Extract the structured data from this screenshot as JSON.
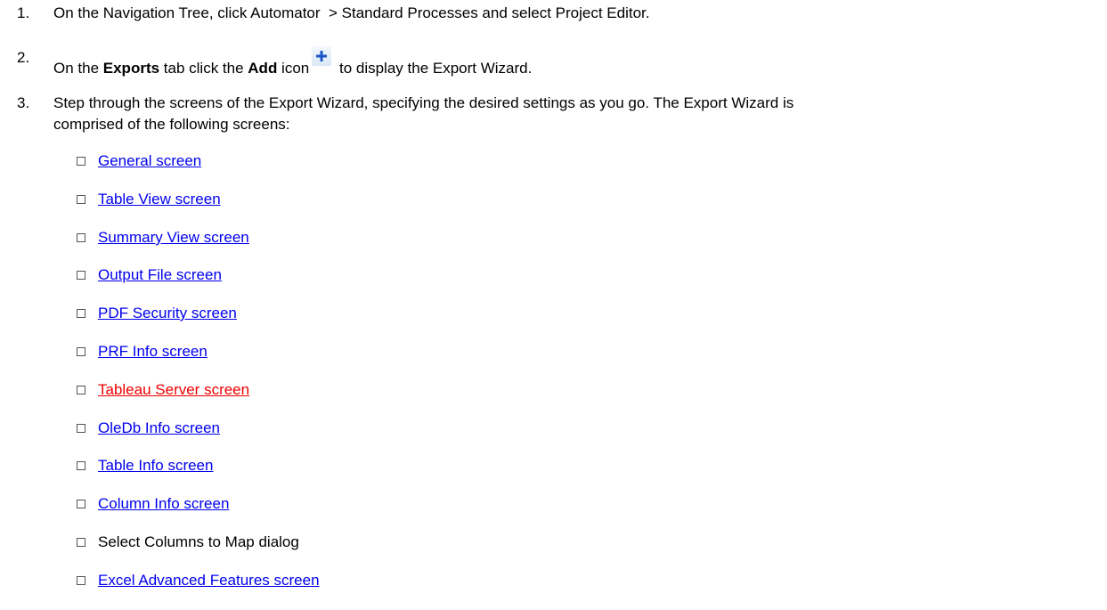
{
  "steps": [
    {
      "number": "1.",
      "text": "On the Navigation Tree, click Automator  > Standard Processes and select Project Editor."
    },
    {
      "number": "2.",
      "t1": "On the ",
      "b1": "Exports",
      "t2": " tab click the ",
      "b2": "Add",
      "t3": " icon",
      "t4": " to display the Export Wizard."
    },
    {
      "number": "3.",
      "line1": "Step through the screens of the Export Wizard, specifying the desired settings as you go. The Export Wizard is",
      "line2": "comprised of the following screens:"
    }
  ],
  "icons": {
    "add": "plus-icon",
    "bullet": "checkbox-square-icon"
  },
  "colors": {
    "link": "#0000ee",
    "link_highlight": "#ee0000",
    "plus": "#1e56c8",
    "text": "#000000"
  },
  "screens": [
    {
      "label": "General screen",
      "link": true,
      "highlight": false
    },
    {
      "label": "Table View screen",
      "link": true,
      "highlight": false
    },
    {
      "label": "Summary View screen",
      "link": true,
      "highlight": false
    },
    {
      "label": "Output File screen",
      "link": true,
      "highlight": false
    },
    {
      "label": "PDF Security screen",
      "link": true,
      "highlight": false
    },
    {
      "label": "PRF Info screen",
      "link": true,
      "highlight": false
    },
    {
      "label": "Tableau Server screen",
      "link": true,
      "highlight": true
    },
    {
      "label": "OleDb Info screen",
      "link": true,
      "highlight": false
    },
    {
      "label": "Table Info screen",
      "link": true,
      "highlight": false
    },
    {
      "label": "Column Info screen",
      "link": true,
      "highlight": false
    },
    {
      "label": "Select Columns to Map dialog",
      "link": false,
      "highlight": false
    },
    {
      "label": "Excel Advanced Features screen",
      "link": true,
      "highlight": false
    }
  ]
}
